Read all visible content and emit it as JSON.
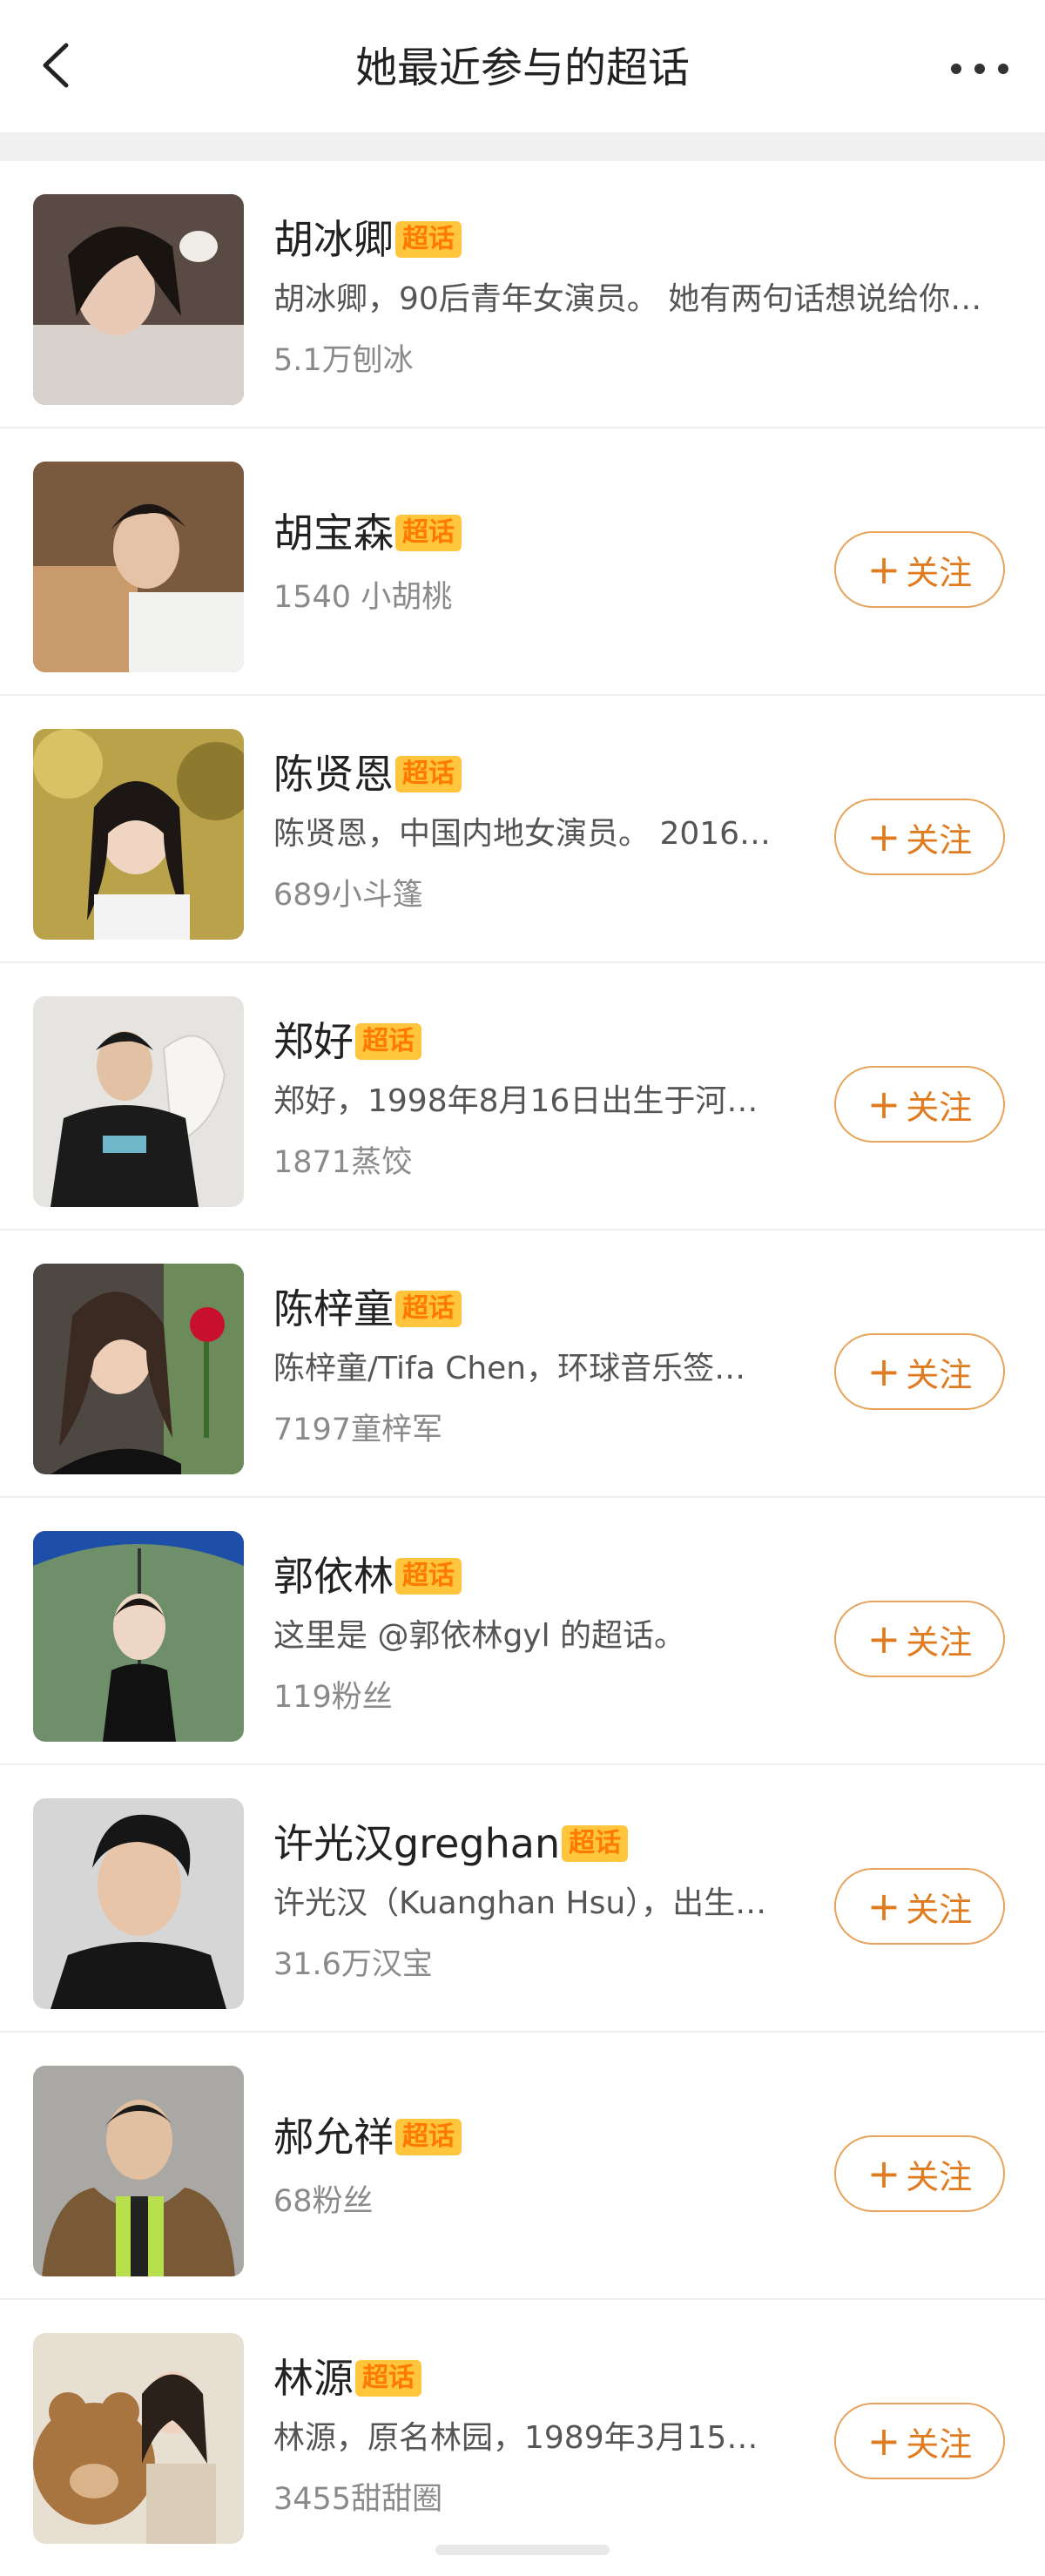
{
  "header": {
    "title": "她最近参与的超话",
    "back_icon": "chevron-left-icon",
    "more_icon": "more-dots-icon"
  },
  "badge_label": "超话",
  "follow_label": "关注",
  "follow_plus": "+",
  "colors": {
    "accent": "#e07b1f",
    "badge_bg": "#ffc53d",
    "badge_text": "#ff7a00"
  },
  "items": [
    {
      "name": "胡冰卿",
      "desc": "胡冰卿，90后青年女演员。 她有两句话想说给你…",
      "fans": "5.1万刨冰",
      "following": true
    },
    {
      "name": "胡宝森",
      "desc": "",
      "fans": "1540 小胡桃",
      "following": false
    },
    {
      "name": "陈贤恩",
      "desc": "陈贤恩，中国内地女演员。 2016…",
      "fans": "689小斗篷",
      "following": false
    },
    {
      "name": "郑好",
      "desc": "郑好，1998年8月16日出生于河…",
      "fans": "1871蒸饺",
      "following": false
    },
    {
      "name": "陈梓童",
      "desc": "陈梓童/Tifa Chen，环球音乐签…",
      "fans": "7197童梓军",
      "following": false
    },
    {
      "name": "郭依林",
      "desc": "这里是 @郭依林gyl 的超话。",
      "fans": "119粉丝",
      "following": false
    },
    {
      "name": "许光汉greghan",
      "desc": "许光汉（Kuanghan Hsu），出生…",
      "fans": "31.6万汉宝",
      "following": false
    },
    {
      "name": "郝允祥",
      "desc": "",
      "fans": "68粉丝",
      "following": false
    },
    {
      "name": "林源",
      "desc": "林源，原名林园，1989年3月15…",
      "fans": "3455甜甜圈",
      "following": false
    }
  ]
}
